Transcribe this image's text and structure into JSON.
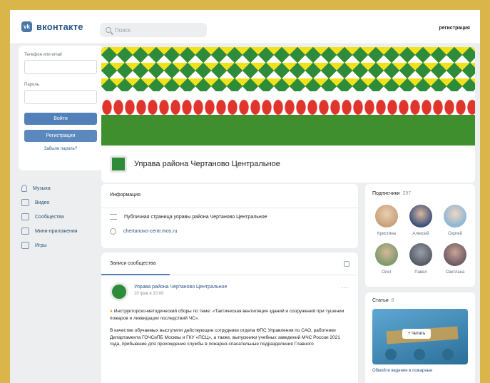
{
  "header": {
    "logo_text": "вконтакте",
    "search_placeholder": "Поиск",
    "register_link": "регистрация"
  },
  "login": {
    "phone_label": "Телефон или email",
    "password_label": "Пароль",
    "login_button": "Войти",
    "register_button": "Регистрация",
    "forgot_link": "Забыли пароль?"
  },
  "leftnav": {
    "items": [
      {
        "label": "Музыка",
        "icon": "music-icon"
      },
      {
        "label": "Видео",
        "icon": "video-icon"
      },
      {
        "label": "Сообщества",
        "icon": "groups-icon"
      },
      {
        "label": "Мини-приложения",
        "icon": "apps-icon"
      },
      {
        "label": "Игры",
        "icon": "games-icon"
      }
    ]
  },
  "community": {
    "name": "Управа района Чертаново Центральное"
  },
  "info": {
    "title": "Информация",
    "description": "Публичная страница управы района Чертаново Центральное",
    "website": "chertanovo-centr.mos.ru"
  },
  "wall": {
    "tab": "Записи сообщества",
    "post": {
      "author": "Управа района Чертаново Центральное",
      "date": "10 фев в 10:00",
      "text1": "Инструкторско-методический сборы по теме: «Тактическая вентиляция зданий и сооружений при тушении пожаров и ликвидации последствий ЧС».",
      "text2": "В качестве обучаемых выступили действующие сотрудники отдела ФПС Управления по САО, работники Департамента ГОЧСиПБ Москвы и ГКУ «ПСЦ», а также, выпускники учебных заведений МЧС России 2021 года, прибывшие для прохождения службы в пожарно-спасательные подразделения Главного"
    }
  },
  "subscribers": {
    "title": "Подписчики",
    "count": "297",
    "people": [
      {
        "name": "Кристина",
        "color": "#c9a07a"
      },
      {
        "name": "Алексей",
        "color": "#3b4f7a"
      },
      {
        "name": "Сергей",
        "color": "#8bb5d6"
      },
      {
        "name": "Олег",
        "color": "#7a9a6a"
      },
      {
        "name": "Павел",
        "color": "#555a66"
      },
      {
        "name": "Светлана",
        "color": "#6e5a63"
      }
    ]
  },
  "articles": {
    "title": "Статьи",
    "count": "8",
    "read_button": "Читать",
    "caption": "Обмойте ведение в пожарные"
  }
}
